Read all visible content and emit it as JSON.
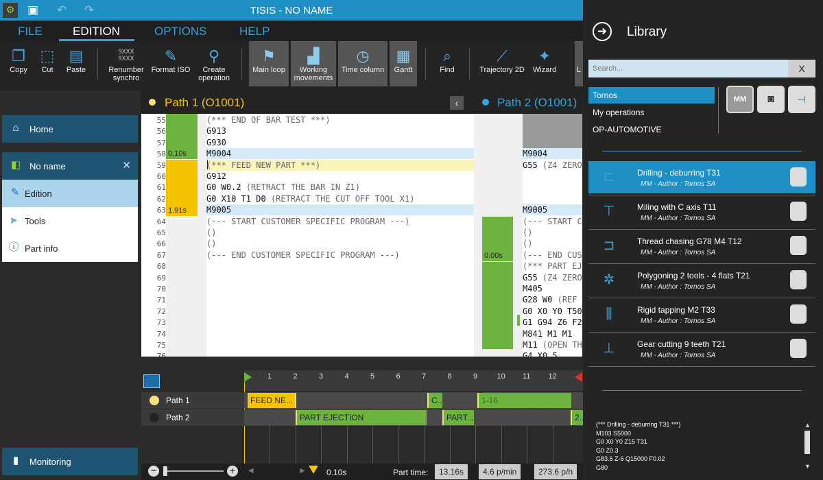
{
  "title": "TISIS - NO NAME",
  "menu": [
    "FILE",
    "EDITION",
    "OPTIONS",
    "HELP"
  ],
  "toolbar": {
    "copy": "Copy",
    "cut": "Cut",
    "paste": "Paste",
    "renumber": "Renumber",
    "synchro": "synchro",
    "renumber_digits": "9XXX",
    "format_iso": "Format ISO",
    "create": "Create",
    "operation": "operation",
    "main_loop": "Main loop",
    "working": "Working",
    "movements": "movements",
    "time_column": "Time column",
    "gantt": "Gantt",
    "find": "Find",
    "trajectory": "Trajectory 2D",
    "wizard": "Wizard",
    "last": "L"
  },
  "sidebar": {
    "home": "Home",
    "project": "No name",
    "edition": "Edition",
    "tools": "Tools",
    "part_info": "Part info",
    "monitoring": "Monitoring"
  },
  "path1": {
    "title": "Path 1 (O1001)",
    "time_a": "0.10s",
    "time_b": "1.91s",
    "lines": [
      {
        "n": "55",
        "c": "(*** END OF BAR TEST ***)"
      },
      {
        "n": "56",
        "c": "G913"
      },
      {
        "n": "57",
        "c": "G930"
      },
      {
        "n": "58",
        "c": "M9004"
      },
      {
        "n": "59",
        "c": "(*** FEED NEW PART ***)"
      },
      {
        "n": "60",
        "c": "G912"
      },
      {
        "n": "61",
        "c": "G0 W0.2",
        "cm": "(RETRACT THE BAR IN Z1)"
      },
      {
        "n": "62",
        "c": "G0 X10 T1 D0",
        "cm": "(RETRACT THE CUT OFF TOOL X1)"
      },
      {
        "n": "63",
        "c": "M9005"
      },
      {
        "n": "64",
        "c": "(--- START CUSTOMER SPECIFIC PROGRAM ---)"
      },
      {
        "n": "65",
        "c": "()"
      },
      {
        "n": "66",
        "c": "()"
      },
      {
        "n": "67",
        "c": "(--- END CUSTOMER SPECIFIC PROGRAM ---)"
      },
      {
        "n": "68",
        "c": ""
      },
      {
        "n": "69",
        "c": ""
      },
      {
        "n": "70",
        "c": ""
      },
      {
        "n": "71",
        "c": ""
      },
      {
        "n": "72",
        "c": ""
      },
      {
        "n": "73",
        "c": ""
      },
      {
        "n": "74",
        "c": ""
      },
      {
        "n": "75",
        "c": ""
      },
      {
        "n": "76",
        "c": ""
      }
    ]
  },
  "path2": {
    "title": "Path 2 (O1001)",
    "time_a": "0.00s",
    "lines": [
      {
        "c": ""
      },
      {
        "c": ""
      },
      {
        "c": ""
      },
      {
        "c": "M9004"
      },
      {
        "c": "G55",
        "cm": "(Z4 ZERO"
      },
      {
        "c": ""
      },
      {
        "c": ""
      },
      {
        "c": ""
      },
      {
        "c": "M9005"
      },
      {
        "c": "(--- START C"
      },
      {
        "c": "()"
      },
      {
        "c": "()"
      },
      {
        "c": "(--- END CUS"
      },
      {
        "c": "(*** PART EJ"
      },
      {
        "c": "G55",
        "cm": "(Z4 ZERO"
      },
      {
        "c": "M405"
      },
      {
        "c": "G28 W0",
        "cm": "(REF"
      },
      {
        "c": "G0 X0 Y0 T50"
      },
      {
        "c": "G1 G94 Z6 F2"
      },
      {
        "c": "M841 M1 M1"
      },
      {
        "c": "M11",
        "cm": "(OPEN TH"
      },
      {
        "c": "G4 X0.5"
      }
    ]
  },
  "timeline": {
    "ticks": [
      "1",
      "2",
      "3",
      "4",
      "5",
      "6",
      "7",
      "8",
      "9",
      "10",
      "11",
      "12"
    ],
    "tracks": [
      "Path 1",
      "Path 2"
    ],
    "seg_p1_a": "FEED NE...",
    "seg_p1_b": "C...",
    "seg_p1_c": "1-16",
    "seg_p2_a": "PART EJECTION",
    "seg_p2_b": "PART...",
    "seg_p2_c": "2..."
  },
  "bottom": {
    "cursor_time": "0.10s",
    "part_time_label": "Part time:",
    "part_time": "13.16s",
    "rate_min": "4.6 p/min",
    "rate_h": "273.6 p/h"
  },
  "library": {
    "title": "Library",
    "search_placeholder": "Search...",
    "clear": "X",
    "categories": [
      "Tornos",
      "My operations",
      "OP-AUTOMOTIVE"
    ],
    "unit": "MM",
    "items": [
      {
        "name": "Drilling - deburring T31",
        "meta": "MM    -   Author : Tornos SA"
      },
      {
        "name": "Miling with C axis T11",
        "meta": "MM    -   Author : Tornos SA"
      },
      {
        "name": "Thread  chasing G78 M4 T12",
        "meta": "MM    -   Author : Tornos SA"
      },
      {
        "name": "Polygoning  2 tools - 4 flats T21",
        "meta": "MM    -   Author : Tornos SA"
      },
      {
        "name": "Rigid tapping M2 T33",
        "meta": "MM    -   Author : Tornos SA"
      },
      {
        "name": "Gear cutting  9 teeth T21",
        "meta": "MM    -   Author : Tornos SA"
      }
    ],
    "code_preview": "(*** Drilling - deburring T31 ***)\nM103 S5000\nG0 X0 Y0 Z15 T31\nG0 Z0.3\nG83.6 Z-6 Q15000 F0.02\nG80"
  },
  "colors": {
    "accent": "#1e8fc4",
    "path1_yellow": "#f5c400",
    "path2_green": "#6cb33f",
    "selected_row": "#1e8fc4"
  }
}
